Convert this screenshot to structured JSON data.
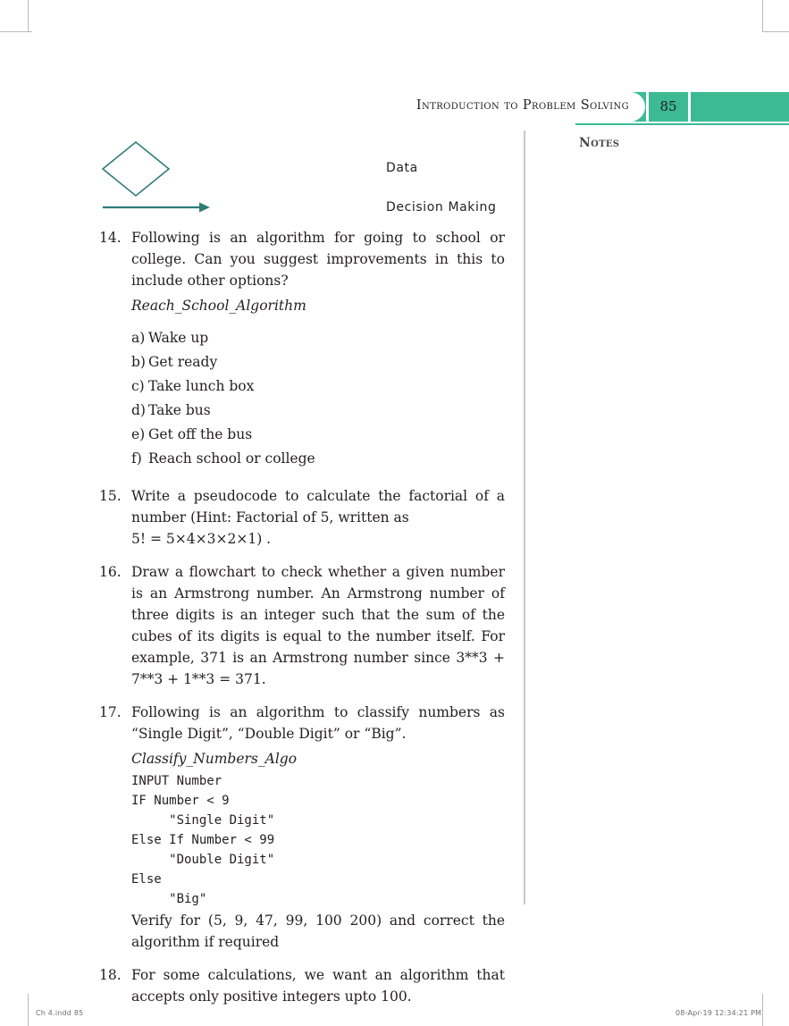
{
  "page": {
    "running_header": "Introduction to Problem Solving",
    "page_number": "85",
    "notes_label": "Notes",
    "accent_green": "#3cba92",
    "flowchart_teal": "#2e7d78"
  },
  "legend": {
    "data_label": "Data",
    "decision_label": "Decision Making",
    "diamond_icon": "diamond-shape",
    "arrow_icon": "flow-arrow"
  },
  "questions": [
    {
      "number": "14.",
      "text": "Following is an algorithm for going to school or college. Can you suggest improvements in this to include other options?",
      "algo_name": "Reach_School_Algorithm",
      "steps": [
        {
          "marker": "a)",
          "label": "Wake up"
        },
        {
          "marker": "b)",
          "label": "Get ready"
        },
        {
          "marker": "c)",
          "label": "Take lunch box"
        },
        {
          "marker": "d)",
          "label": "Take bus"
        },
        {
          "marker": "e)",
          "label": "Get off the bus"
        },
        {
          "marker": "f)",
          "label": "Reach school or college"
        }
      ]
    },
    {
      "number": "15.",
      "text": "Write a pseudocode to calculate the factorial of a number (Hint: Factorial of 5, written as",
      "formula": "5! = 5×4×3×2×1) ."
    },
    {
      "number": "16.",
      "text": "Draw a flowchart to check whether a given number is an Armstrong number. An Armstrong number of three digits is an integer such that the sum of the cubes of its digits is equal to the number itself. For example, 371 is an Armstrong number since 3**3 + 7**3 + 1**3 = 371."
    },
    {
      "number": "17.",
      "text": "Following is an algorithm to classify numbers as “Single Digit”, “Double Digit” or “Big”.",
      "algo_name": "Classify_Numbers_Algo",
      "code": "INPUT Number\nIF Number < 9\n     \"Single Digit\"\nElse If Number < 99\n     \"Double Digit\"\nElse\n     \"Big\"",
      "verify": "Verify for (5, 9, 47, 99, 100 200) and correct the algorithm if required"
    },
    {
      "number": "18.",
      "text": "For some calculations, we want an algorithm that accepts only positive integers upto 100."
    }
  ],
  "footer": {
    "left": "Ch 4.indd   85",
    "right": "08-Apr-19   12:34:21 PM"
  }
}
